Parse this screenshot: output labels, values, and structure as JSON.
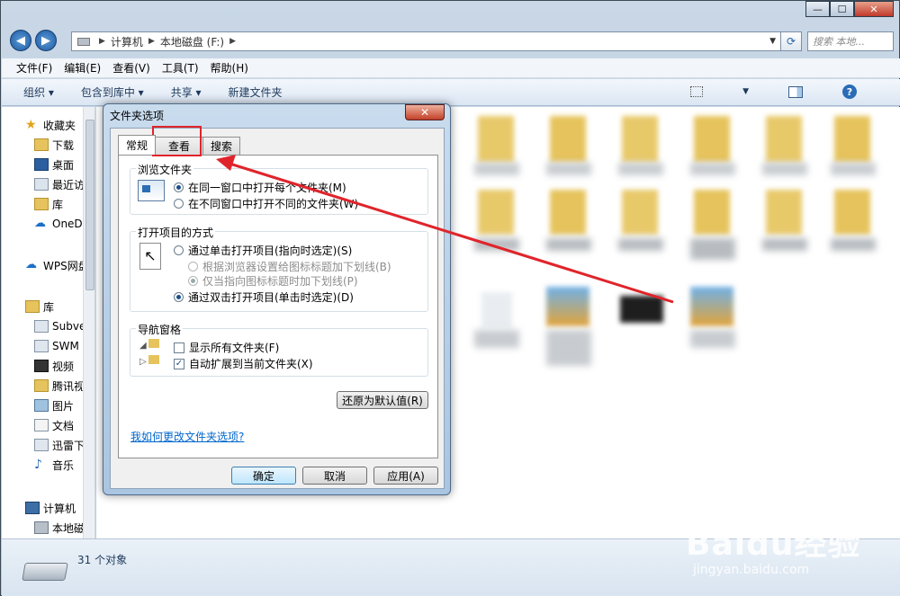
{
  "window": {
    "caption_buttons": [
      "—",
      "☐",
      "✕"
    ]
  },
  "address": {
    "back": "◀",
    "forward": "▶",
    "crumbs": [
      "计算机",
      "本地磁盘 (F:)"
    ],
    "search_placeholder": "搜索 本地..."
  },
  "menu": {
    "items": [
      "文件(F)",
      "编辑(E)",
      "查看(V)",
      "工具(T)",
      "帮助(H)"
    ]
  },
  "toolbar": {
    "items": [
      "组织 ▾",
      "包含到库中 ▾",
      "共享 ▾",
      "新建文件夹"
    ]
  },
  "sidebar": {
    "favorites": "收藏夹",
    "fav_items": [
      "下载",
      "桌面",
      "最近访",
      "库",
      "OneD"
    ],
    "wps": "WPS网盘",
    "library": "库",
    "lib_items": [
      "Subve",
      "SWM",
      "视频",
      "腾讯视",
      "图片",
      "文档",
      "迅雷下",
      "音乐"
    ],
    "computer": "计算机",
    "computer_items": [
      "本地磁"
    ]
  },
  "status": {
    "count": "31 个对象"
  },
  "watermark": {
    "logo": "Baidu经验",
    "url": "jingyan.baidu.com"
  },
  "dialog": {
    "title": "文件夹选项",
    "close": "✕",
    "tabs": [
      "常规",
      "查看",
      "搜索"
    ],
    "browse": {
      "label": "浏览文件夹",
      "opt1": "在同一窗口中打开每个文件夹(M)",
      "opt2": "在不同窗口中打开不同的文件夹(W)"
    },
    "open": {
      "label": "打开项目的方式",
      "opt1": "通过单击打开项目(指向时选定)(S)",
      "sub1": "根据浏览器设置给图标标题加下划线(B)",
      "sub2": "仅当指向图标标题时加下划线(P)",
      "opt2": "通过双击打开项目(单击时选定)(D)"
    },
    "nav": {
      "label": "导航窗格",
      "opt1": "显示所有文件夹(F)",
      "opt2": "自动扩展到当前文件夹(X)"
    },
    "restore": "还原为默认值(R)",
    "help_link": "我如何更改文件夹选项?",
    "ok": "确定",
    "cancel": "取消",
    "apply": "应用(A)"
  },
  "colors": {
    "highlight": "#e0242b",
    "link": "#0066cc"
  }
}
